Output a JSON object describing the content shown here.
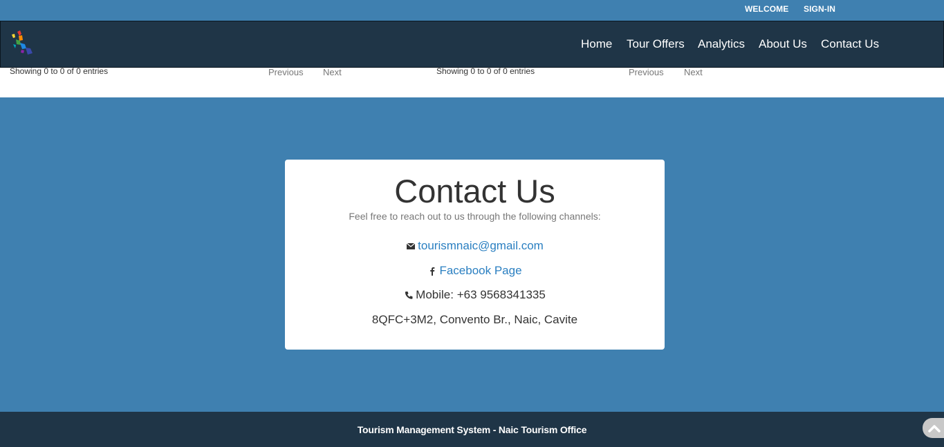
{
  "topbar": {
    "welcome": "WELCOME",
    "signin": "SIGN-IN"
  },
  "nav": {
    "home": "Home",
    "tour_offers": "Tour Offers",
    "analytics": "Analytics",
    "about": "About Us",
    "contact": "Contact Us"
  },
  "tables": [
    {
      "info": "Showing 0 to 0 of 0 entries",
      "previous": "Previous",
      "next": "Next"
    },
    {
      "info": "Showing 0 to 0 of 0 entries",
      "previous": "Previous",
      "next": "Next"
    }
  ],
  "contact": {
    "title": "Contact Us",
    "subtitle": "Feel free to reach out to us through the following channels:",
    "email": "tourismnaic@gmail.com",
    "facebook": "Facebook Page",
    "mobile": "Mobile: +63 9568341335",
    "address": "8QFC+3M2, Convento Br., Naic, Cavite"
  },
  "footer": {
    "text": "Tourism Management System - Naic Tourism Office"
  },
  "icons": {
    "email": "envelope-icon",
    "facebook": "facebook-icon",
    "phone": "phone-icon",
    "back_to_top": "chevron-up-icon"
  },
  "colors": {
    "background": "#3f80b0",
    "navbar": "#1f3547",
    "link": "#2a7fc1"
  }
}
